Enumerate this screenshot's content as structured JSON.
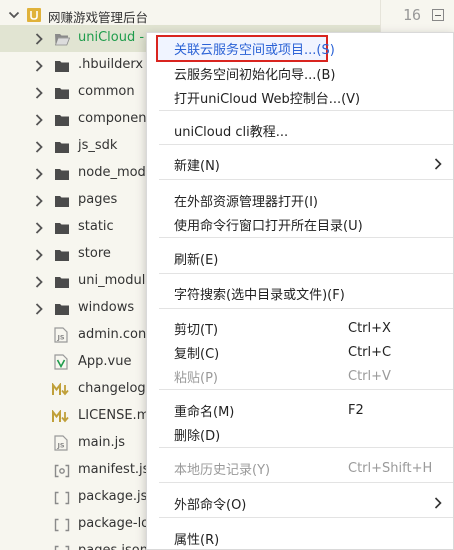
{
  "tree": {
    "root": {
      "label": "网赚游戏管理后台"
    },
    "items": [
      {
        "label": "uniCloud - ",
        "type": "folder",
        "selected": true
      },
      {
        "label": ".hbuilderx",
        "type": "folder"
      },
      {
        "label": "common",
        "type": "folder"
      },
      {
        "label": "component",
        "type": "folder"
      },
      {
        "label": "js_sdk",
        "type": "folder"
      },
      {
        "label": "node_modu",
        "type": "folder"
      },
      {
        "label": "pages",
        "type": "folder"
      },
      {
        "label": "static",
        "type": "folder"
      },
      {
        "label": "store",
        "type": "folder"
      },
      {
        "label": "uni_module",
        "type": "folder"
      },
      {
        "label": "windows",
        "type": "folder"
      },
      {
        "label": "admin.confi",
        "type": "js"
      },
      {
        "label": "App.vue",
        "type": "vue"
      },
      {
        "label": "changelog.r",
        "type": "md"
      },
      {
        "label": "LICENSE.mc",
        "type": "md"
      },
      {
        "label": "main.js",
        "type": "js"
      },
      {
        "label": "manifest.jsc",
        "type": "json-obj"
      },
      {
        "label": "package.jsc",
        "type": "json"
      },
      {
        "label": "package-loc",
        "type": "json"
      },
      {
        "label": "pages.json",
        "type": "json"
      }
    ]
  },
  "editor": {
    "line_number": "16"
  },
  "menu": {
    "items": [
      {
        "label": "关联云服务空间或项目...(S)",
        "highlight": true
      },
      {
        "label": "云服务空间初始化向导...(B)"
      },
      {
        "label": "打开uniCloud Web控制台...(V)"
      },
      {
        "label": "uniCloud cli教程..."
      },
      {
        "label": "新建(N)",
        "submenu": true
      },
      {
        "label": "在外部资源管理器打开(I)"
      },
      {
        "label": "使用命令行窗口打开所在目录(U)"
      },
      {
        "label": "刷新(E)"
      },
      {
        "label": "字符搜索(选中目录或文件)(F)"
      },
      {
        "label": "剪切(T)",
        "shortcut": "Ctrl+X"
      },
      {
        "label": "复制(C)",
        "shortcut": "Ctrl+C"
      },
      {
        "label": "粘贴(P)",
        "shortcut": "Ctrl+V",
        "disabled": true
      },
      {
        "label": "重命名(M)",
        "shortcut": "F2"
      },
      {
        "label": "删除(D)"
      },
      {
        "label": "本地历史记录(Y)",
        "shortcut": "Ctrl+Shift+H",
        "disabled": true
      },
      {
        "label": "外部命令(O)",
        "submenu": true
      },
      {
        "label": "属性(R)"
      }
    ]
  },
  "colors": {
    "accent_green": "#1f9c4c",
    "highlight_border": "#d9241f",
    "highlight_text": "#2c63d6",
    "folder_icon": "#4b4b4b",
    "md_icon": "#c0a03a",
    "vue_icon": "#1f9c4c"
  },
  "icons": {
    "root": "project-icon",
    "folder": "folder-icon",
    "caret_open": "chevron-down-icon",
    "caret_closed": "chevron-right-icon",
    "submenu": "chevron-right-icon",
    "fold": "fold-minus-icon"
  }
}
